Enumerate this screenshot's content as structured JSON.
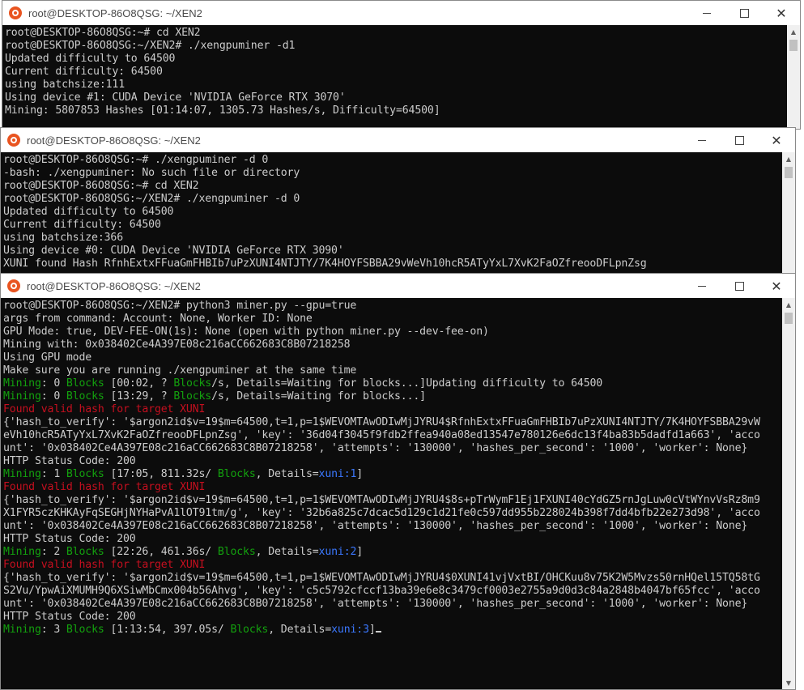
{
  "windows": [
    {
      "title": "root@DESKTOP-86O8QSG: ~/XEN2",
      "lines": [
        [
          {
            "t": "root@DESKTOP-86O8QSG:~# cd XEN2"
          }
        ],
        [
          {
            "t": "root@DESKTOP-86O8QSG:~/XEN2# ./xengpuminer -d1"
          }
        ],
        [
          {
            "t": "Updated difficulty to 64500"
          }
        ],
        [
          {
            "t": "Current difficulty: 64500"
          }
        ],
        [
          {
            "t": "using batchsize:111"
          }
        ],
        [
          {
            "t": "Using device #1: CUDA Device 'NVIDIA GeForce RTX 3070'"
          }
        ],
        [
          {
            "t": "Mining: 5807853 Hashes [01:14:07, 1305.73 Hashes/s, Difficulty=64500]"
          }
        ]
      ]
    },
    {
      "title": "root@DESKTOP-86O8QSG: ~/XEN2",
      "lines": [
        [
          {
            "t": "root@DESKTOP-86O8QSG:~# ./xengpuminer -d 0"
          }
        ],
        [
          {
            "t": "-bash: ./xengpuminer: No such file or directory"
          }
        ],
        [
          {
            "t": "root@DESKTOP-86O8QSG:~# cd XEN2"
          }
        ],
        [
          {
            "t": "root@DESKTOP-86O8QSG:~/XEN2# ./xengpuminer -d 0"
          }
        ],
        [
          {
            "t": "Updated difficulty to 64500"
          }
        ],
        [
          {
            "t": "Current difficulty: 64500"
          }
        ],
        [
          {
            "t": "using batchsize:366"
          }
        ],
        [
          {
            "t": "Using device #0: CUDA Device 'NVIDIA GeForce RTX 3090'"
          }
        ],
        [
          {
            "t": "XUNI found Hash RfnhExtxFFuaGmFHBIb7uPzXUNI4NTJTY/7K4HOYFSBBA29vWeVh10hcR5ATyYxL7XvK2FaOZfreooDFLpnZsg"
          }
        ]
      ]
    },
    {
      "title": "root@DESKTOP-86O8QSG: ~/XEN2",
      "lines": [
        [
          {
            "t": "root@DESKTOP-86O8QSG:~/XEN2# python3 miner.py --gpu=true"
          }
        ],
        [
          {
            "t": "args from command: Account: None, Worker ID: None"
          }
        ],
        [
          {
            "t": "GPU Mode: true, DEV-FEE-ON(1s): None (open with python miner.py --dev-fee-on)"
          }
        ],
        [
          {
            "t": "Mining with: 0x038402Ce4A397E08c216aCC662683C8B07218258"
          }
        ],
        [
          {
            "t": "Using GPU mode"
          }
        ],
        [
          {
            "t": "Make sure you are running ./xengpuminer at the same time"
          }
        ],
        [
          {
            "t": "Mining",
            "c": "g"
          },
          {
            "t": ": 0 "
          },
          {
            "t": "Blocks",
            "c": "g"
          },
          {
            "t": " [00:02, ? "
          },
          {
            "t": "Blocks",
            "c": "g"
          },
          {
            "t": "/s, Details=Waiting for blocks...]Updating difficulty to 64500"
          }
        ],
        [
          {
            "t": "Mining",
            "c": "g"
          },
          {
            "t": ": 0 "
          },
          {
            "t": "Blocks",
            "c": "g"
          },
          {
            "t": " [13:29, ? "
          },
          {
            "t": "Blocks",
            "c": "g"
          },
          {
            "t": "/s, Details=Waiting for blocks...]"
          }
        ],
        [
          {
            "t": "Found valid hash for target XUNI",
            "c": "r"
          }
        ],
        [
          {
            "t": "{'hash_to_verify': '$argon2id$v=19$m=64500,t=1,p=1$WEVOMTAwODIwMjJYRU4$RfnhExtxFFuaGmFHBIb7uPzXUNI4NTJTY/7K4HOYFSBBA29vW"
          }
        ],
        [
          {
            "t": "eVh10hcR5ATyYxL7XvK2FaOZfreooDFLpnZsg', 'key': '36d04f3045f9fdb2ffea940a08ed13547e780126e6dc13f4ba83b5dadfd1a663', 'acco"
          }
        ],
        [
          {
            "t": "unt': '0x038402Ce4A397E08c216aCC662683C8B07218258', 'attempts': '130000', 'hashes_per_second': '1000', 'worker': None}"
          }
        ],
        [
          {
            "t": "HTTP Status Code: 200"
          }
        ],
        [
          {
            "t": "Mining",
            "c": "g"
          },
          {
            "t": ": 1 "
          },
          {
            "t": "Blocks",
            "c": "g"
          },
          {
            "t": " [17:05, 811.32s/ "
          },
          {
            "t": "Blocks",
            "c": "g"
          },
          {
            "t": ", Details="
          },
          {
            "t": "xuni:1",
            "c": "b"
          },
          {
            "t": "]"
          }
        ],
        [
          {
            "t": "Found valid hash for target XUNI",
            "c": "r"
          }
        ],
        [
          {
            "t": "{'hash_to_verify': '$argon2id$v=19$m=64500,t=1,p=1$WEVOMTAwODIwMjJYRU4$8s+pTrWymF1Ej1FXUNI40cYdGZ5rnJgLuw0cVtWYnvVsRz8m9"
          }
        ],
        [
          {
            "t": "X1FYR5czKHKAyFqSEGHjNYHaPvA1lOT91tm/g', 'key': '32b6a825c7dcac5d129c1d21fe0c597dd955b228024b398f7dd4bfb22e273d98', 'acco"
          }
        ],
        [
          {
            "t": "unt': '0x038402Ce4A397E08c216aCC662683C8B07218258', 'attempts': '130000', 'hashes_per_second': '1000', 'worker': None}"
          }
        ],
        [
          {
            "t": "HTTP Status Code: 200"
          }
        ],
        [
          {
            "t": "Mining",
            "c": "g"
          },
          {
            "t": ": 2 "
          },
          {
            "t": "Blocks",
            "c": "g"
          },
          {
            "t": " [22:26, 461.36s/ "
          },
          {
            "t": "Blocks",
            "c": "g"
          },
          {
            "t": ", Details="
          },
          {
            "t": "xuni:2",
            "c": "b"
          },
          {
            "t": "]"
          }
        ],
        [
          {
            "t": "Found valid hash for target XUNI",
            "c": "r"
          }
        ],
        [
          {
            "t": "{'hash_to_verify': '$argon2id$v=19$m=64500,t=1,p=1$WEVOMTAwODIwMjJYRU4$0XUNI41vjVxtBI/OHCKuu8v75K2W5Mvzs50rnHQel15TQ58tG"
          }
        ],
        [
          {
            "t": "S2Vu/YpwAiXMUMH9Q6XSiwMbCmx004b56Ahvg', 'key': 'c5c5792cfccf13ba39e6e8c3479cf0003e2755a9d0d3c84a2848b4047bf65fcc', 'acco"
          }
        ],
        [
          {
            "t": "unt': '0x038402Ce4A397E08c216aCC662683C8B07218258', 'attempts': '130000', 'hashes_per_second': '1000', 'worker': None}"
          }
        ],
        [
          {
            "t": "HTTP Status Code: 200"
          }
        ],
        [
          {
            "t": "Mining",
            "c": "g"
          },
          {
            "t": ": 3 "
          },
          {
            "t": "Blocks",
            "c": "g"
          },
          {
            "t": " [1:13:54, 397.05s/ "
          },
          {
            "t": "Blocks",
            "c": "g"
          },
          {
            "t": ", Details="
          },
          {
            "t": "xuni:3",
            "c": "b"
          },
          {
            "t": "]"
          }
        ]
      ]
    }
  ],
  "controls": {
    "minimize": "—",
    "maximize": "☐",
    "close": "✕"
  },
  "colors": {
    "terminal_bg": "#0c0c0c",
    "terminal_text": "#cccccc",
    "green": "#13a10e",
    "red": "#c50f1f",
    "blue": "#3b78ff",
    "ubuntu_orange": "#e95420"
  }
}
